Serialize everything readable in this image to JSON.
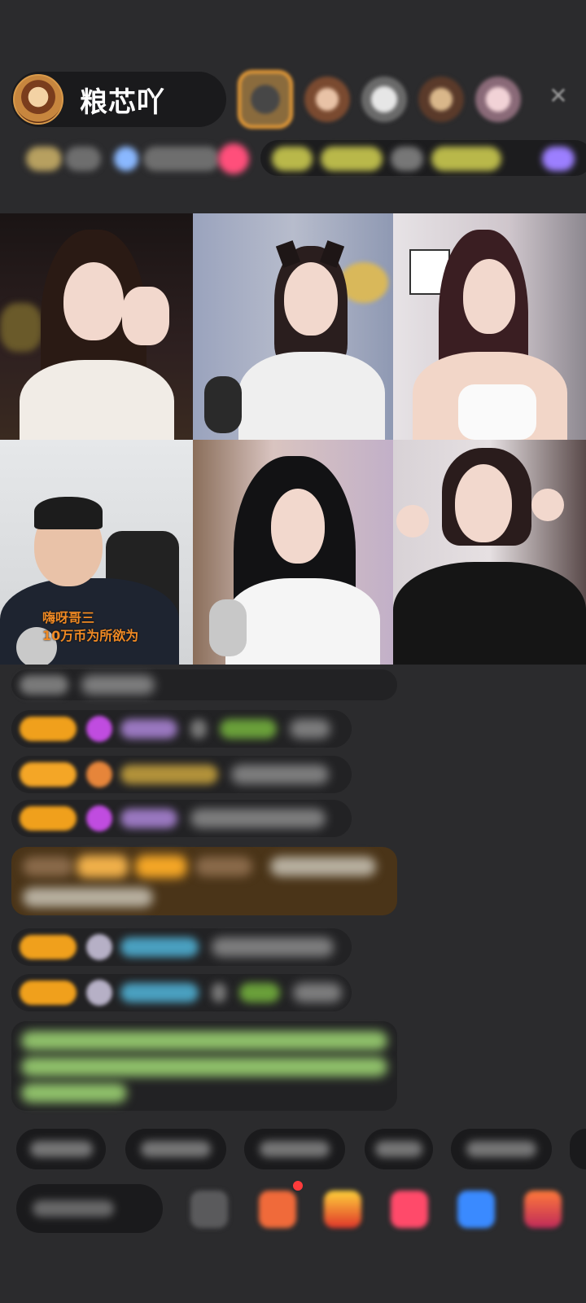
{
  "host": {
    "name": "粮芯吖",
    "avatar_icon": "host-avatar"
  },
  "header": {
    "close_icon": "close-icon",
    "close_glyph": "✕"
  },
  "video_grid": {
    "overlay_text_line1": "嗨呀哥三",
    "overlay_text_line2": "10万币为所欲为"
  },
  "colors": {
    "background": "#2b2b2d",
    "level_badge": "#f0a01c",
    "accent_orange": "#f3a237",
    "overlay_text": "#f08a24",
    "highlight_message_bg": "#4a3418",
    "system_message_text": "#8fc06a",
    "notification_dot": "#ff3b3b"
  }
}
